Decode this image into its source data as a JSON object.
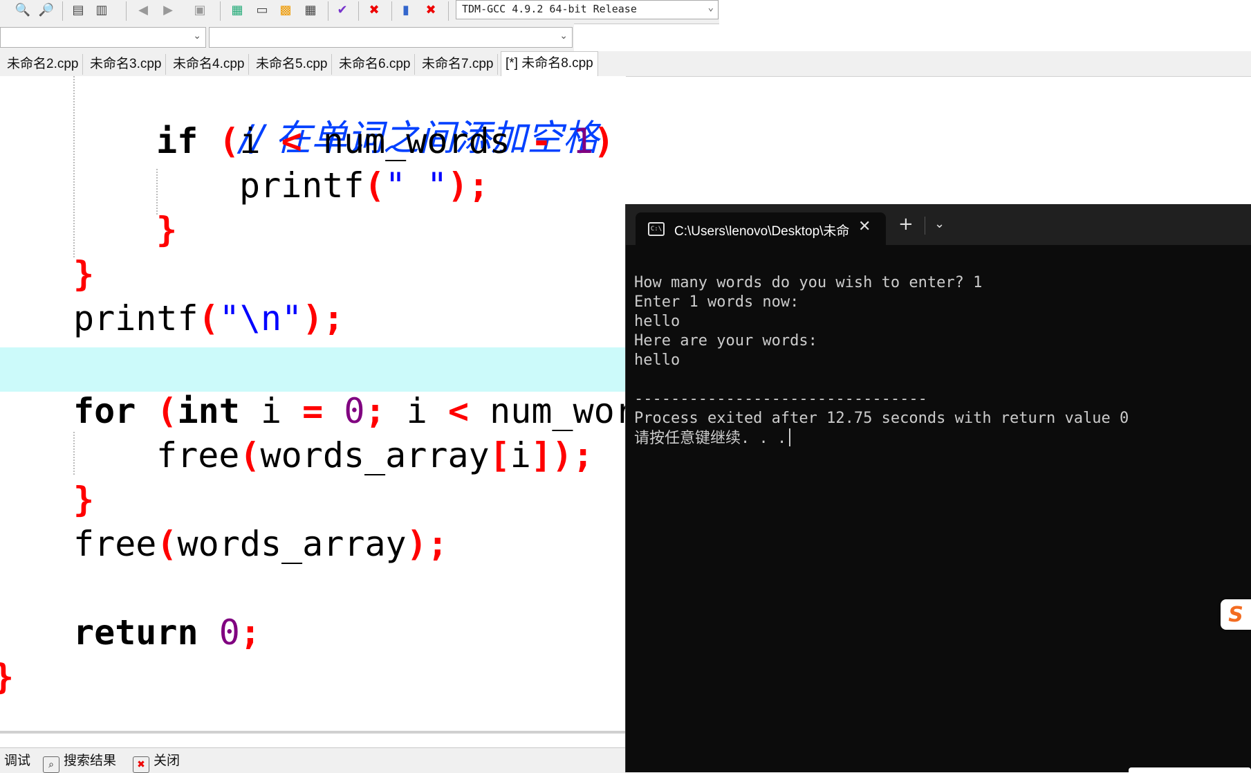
{
  "toolbar": {
    "compiler": "TDM-GCC 4.9.2 64-bit Release",
    "icons": [
      "find-icon",
      "find-replace-icon",
      "indent-icon",
      "unindent-icon",
      "bookmark-back-icon",
      "bookmark-fwd-icon",
      "toggle-icon",
      "new-class-icon",
      "window-icon",
      "tile-icon",
      "grid-icon",
      "check-icon",
      "stop-icon",
      "chart-icon",
      "debug-stop-icon"
    ]
  },
  "tabs": [
    {
      "label": "未命名2.cpp"
    },
    {
      "label": "未命名3.cpp"
    },
    {
      "label": "未命名4.cpp"
    },
    {
      "label": "未命名5.cpp"
    },
    {
      "label": "未命名6.cpp"
    },
    {
      "label": "未命名7.cpp"
    },
    {
      "label": "[*] 未命名8.cpp"
    }
  ],
  "code": {
    "l1": {
      "a": "// 在单词之间添加空格（最后一个单词后不加）"
    },
    "l2": {
      "a": "if",
      "b": " (",
      "c": "i ",
      "d": "<",
      "e": " num_words ",
      "f": "-",
      "g": " 1",
      "h": ")",
      "i": " {"
    },
    "l3": {
      "a": "printf",
      "b": "(",
      "c": "\" \"",
      "d": ");"
    },
    "l4": {
      "a": "}"
    },
    "l5": {
      "a": "}"
    },
    "l6": {
      "a": "printf",
      "b": "(",
      "c": "\"\\n\"",
      "d": ");"
    },
    "l7": {
      "a": "for",
      "b": " (",
      "c": "int",
      "d": " i ",
      "e": "=",
      "f": " 0",
      "g": ";",
      "h": " i ",
      "i": "<",
      "j": " num_wor"
    },
    "l8": {
      "a": "free",
      "b": "(",
      "c": "words_array",
      "d": "[",
      "e": "i",
      "f": "]);"
    },
    "l9": {
      "a": "}"
    },
    "l10": {
      "a": "free",
      "b": "(",
      "c": "words_array",
      "d": ");"
    },
    "l11": {
      "a": "return",
      "b": " 0",
      "c": ";"
    },
    "l12": {
      "a": "}"
    }
  },
  "bottom": {
    "debug": "调试",
    "search_results": "搜索结果",
    "close": "关闭"
  },
  "terminal": {
    "tab_title": "C:\\Users\\lenovo\\Desktop\\未命",
    "close_glyph": "✕",
    "new_tab_glyph": "+",
    "dropdown_glyph": "⌄",
    "lines": [
      "How many words do you wish to enter? 1",
      "Enter 1 words now:",
      "hello",
      "Here are your words:",
      "hello",
      "",
      "--------------------------------",
      "Process exited after 12.75 seconds with return value 0",
      "请按任意键继续. . ."
    ]
  },
  "ime": {
    "label": "S"
  },
  "colors": {
    "keyword": "#000000",
    "operator": "#ff0000",
    "number": "#800080",
    "string": "#0000ff",
    "comment": "#0040ff",
    "highlight_line": "#ccfafa",
    "terminal_bg": "#0c0c0c",
    "terminal_fg": "#cccccc"
  }
}
